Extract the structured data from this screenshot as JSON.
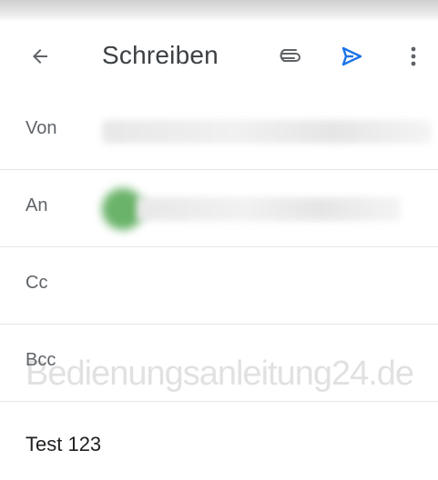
{
  "header": {
    "title": "Schreiben",
    "icons": [
      "back-arrow-icon",
      "paperclip-icon",
      "send-icon",
      "more-vert-icon"
    ],
    "send_color": "#1a73e8"
  },
  "fields": {
    "from_label": "Von",
    "to_label": "An",
    "cc_label": "Cc",
    "bcc_label": "Bcc"
  },
  "subject": "Test 123",
  "watermark": "Bedienungsanleitung24.de"
}
